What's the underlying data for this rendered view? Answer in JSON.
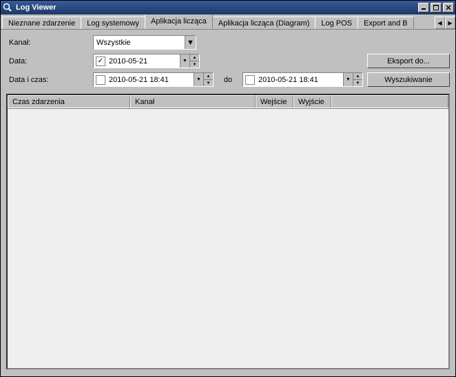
{
  "window": {
    "title": "Log Viewer"
  },
  "tabs": {
    "items": [
      {
        "label": "Nieznane zdarzenie",
        "active": false
      },
      {
        "label": "Log systemowy",
        "active": false
      },
      {
        "label": "Aplikacja licząca",
        "active": true
      },
      {
        "label": "Aplikacja licząca (Diagram)",
        "active": false
      },
      {
        "label": "Log POS",
        "active": false
      },
      {
        "label": "Export and B",
        "active": false
      }
    ]
  },
  "filters": {
    "channel_label": "Kanał:",
    "channel_value": "Wszystkie",
    "date_label": "Data:",
    "date_value": "2010-05-21",
    "date_checked": "✓",
    "datetime_label": "Data i czas:",
    "datetime_from": "2010-05-21 18:41",
    "to_label": "do",
    "datetime_to": "2010-05-21 18:41",
    "datetime_from_checked": "",
    "datetime_to_checked": ""
  },
  "buttons": {
    "export": "Eksport do...",
    "search": "Wyszukiwanie"
  },
  "table": {
    "columns": [
      "Czas zdarzenia",
      "Kanał",
      "Wejście",
      "Wyjście",
      ""
    ],
    "rows": []
  },
  "glyphs": {
    "triangle_down": "▼",
    "triangle_up": "▲",
    "triangle_left": "◀",
    "triangle_right": "▶"
  }
}
